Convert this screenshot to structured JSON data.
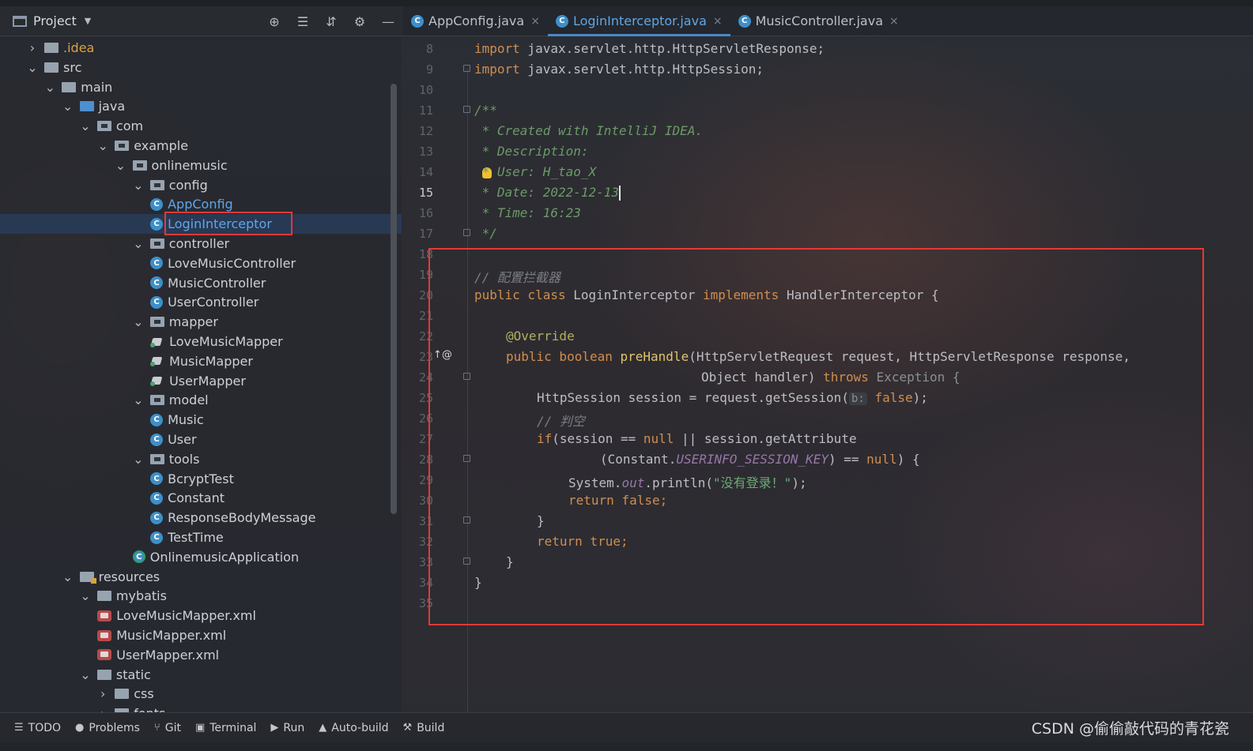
{
  "project_panel": {
    "title": "Project",
    "tools": [
      "locate-icon",
      "expand-all-icon",
      "collapse-all-icon",
      "gear-icon",
      "minimize-icon"
    ]
  },
  "tabs": [
    {
      "label": "AppConfig.java",
      "active": false
    },
    {
      "label": "LoginInterceptor.java",
      "active": true
    },
    {
      "label": "MusicController.java",
      "active": false
    }
  ],
  "tree": [
    {
      "label": ".idea",
      "type": "folder",
      "indent": 1,
      "chev": "right",
      "color": "orange"
    },
    {
      "label": "src",
      "type": "folder",
      "indent": 1,
      "chev": "down"
    },
    {
      "label": "main",
      "type": "folder",
      "indent": 2,
      "chev": "down"
    },
    {
      "label": "java",
      "type": "folder-blue",
      "indent": 3,
      "chev": "down"
    },
    {
      "label": "com",
      "type": "package",
      "indent": 4,
      "chev": "down"
    },
    {
      "label": "example",
      "type": "package",
      "indent": 5,
      "chev": "down"
    },
    {
      "label": "onlinemusic",
      "type": "package",
      "indent": 6,
      "chev": "down"
    },
    {
      "label": "config",
      "type": "package",
      "indent": 7,
      "chev": "down"
    },
    {
      "label": "AppConfig",
      "type": "class",
      "indent": 8,
      "color": "blue"
    },
    {
      "label": "LoginInterceptor",
      "type": "class",
      "indent": 8,
      "color": "blue",
      "selected": true
    },
    {
      "label": "controller",
      "type": "package",
      "indent": 7,
      "chev": "down"
    },
    {
      "label": "LoveMusicController",
      "type": "class",
      "indent": 8
    },
    {
      "label": "MusicController",
      "type": "class",
      "indent": 8
    },
    {
      "label": "UserController",
      "type": "class",
      "indent": 8
    },
    {
      "label": "mapper",
      "type": "package",
      "indent": 7,
      "chev": "down"
    },
    {
      "label": "LoveMusicMapper",
      "type": "mapper",
      "indent": 8
    },
    {
      "label": "MusicMapper",
      "type": "mapper",
      "indent": 8
    },
    {
      "label": "UserMapper",
      "type": "mapper",
      "indent": 8
    },
    {
      "label": "model",
      "type": "package",
      "indent": 7,
      "chev": "down"
    },
    {
      "label": "Music",
      "type": "class",
      "indent": 8
    },
    {
      "label": "User",
      "type": "class",
      "indent": 8
    },
    {
      "label": "tools",
      "type": "package",
      "indent": 7,
      "chev": "down"
    },
    {
      "label": "BcryptTest",
      "type": "class",
      "indent": 8
    },
    {
      "label": "Constant",
      "type": "class",
      "indent": 8
    },
    {
      "label": "ResponseBodyMessage",
      "type": "class",
      "indent": 8
    },
    {
      "label": "TestTime",
      "type": "class",
      "indent": 8
    },
    {
      "label": "OnlinemusicApplication",
      "type": "class-app",
      "indent": 7
    },
    {
      "label": "resources",
      "type": "folder-res",
      "indent": 3,
      "chev": "down"
    },
    {
      "label": "mybatis",
      "type": "folder",
      "indent": 4,
      "chev": "down"
    },
    {
      "label": "LoveMusicMapper.xml",
      "type": "xml",
      "indent": 5
    },
    {
      "label": "MusicMapper.xml",
      "type": "xml",
      "indent": 5
    },
    {
      "label": "UserMapper.xml",
      "type": "xml",
      "indent": 5
    },
    {
      "label": "static",
      "type": "folder",
      "indent": 4,
      "chev": "down"
    },
    {
      "label": "css",
      "type": "folder",
      "indent": 5,
      "chev": "right"
    },
    {
      "label": "fonts",
      "type": "folder",
      "indent": 5,
      "chev": "right"
    }
  ],
  "editor": {
    "line_numbers": [
      "8",
      "9",
      "10",
      "11",
      "12",
      "13",
      "14",
      "15",
      "16",
      "17",
      "18",
      "19",
      "20",
      "21",
      "22",
      "23",
      "24",
      "25",
      "26",
      "27",
      "28",
      "29",
      "30",
      "31",
      "32",
      "33",
      "34",
      "35"
    ],
    "current_line": "15",
    "code": {
      "l8_kw": "import",
      "l8_rest": " javax.servlet.http.HttpServletResponse;",
      "l9_kw": "import",
      "l9_rest": " javax.servlet.http.HttpSession;",
      "l11": "/**",
      "l12": " * Created with IntelliJ IDEA.",
      "l13": " * Description:",
      "l14": " * User: H_tao_X",
      "l15": " * Date: 2022-12-13",
      "l16": " * Time: 16:23",
      "l17": " */",
      "l19": "// 配置拦截器",
      "l20_kw1": "public class",
      "l20_name": " LoginInterceptor ",
      "l20_kw2": "implements",
      "l20_rest": " HandlerInterceptor {",
      "l22": "@Override",
      "l23_kw": "public boolean ",
      "l23_fn": "preHandle",
      "l23_rest": "(HttpServletRequest request, HttpServletResponse response,",
      "l24_a": "Object handler) ",
      "l24_kw": "throws",
      "l24_b": " Exception {",
      "l25_a": "HttpSession session = request.getSession(",
      "l25_hint": "b:",
      "l25_kw": " false",
      "l25_b": ");",
      "l26": "// 判空",
      "l27_kw": "if",
      "l27_a": "(session == ",
      "l27_null": "null",
      "l27_b": " || session.getAttribute",
      "l28_a": "(Constant.",
      "l28_const": "USERINFO_SESSION_KEY",
      "l28_b": ") == ",
      "l28_null": "null",
      "l28_c": ") {",
      "l29_a": "System.",
      "l29_out": "out",
      "l29_b": ".println(",
      "l29_str": "\"没有登录！\"",
      "l29_c": ");",
      "l30": "return false;",
      "l31": "}",
      "l32": "return true;",
      "l33": "}",
      "l34": "}"
    }
  },
  "bottom_bar": [
    {
      "icon": "todo-icon",
      "glyph": "☰",
      "label": "TODO"
    },
    {
      "icon": "problems-icon",
      "glyph": "●",
      "label": "Problems"
    },
    {
      "icon": "git-icon",
      "glyph": "⑂",
      "label": "Git"
    },
    {
      "icon": "terminal-icon",
      "glyph": "▣",
      "label": "Terminal"
    },
    {
      "icon": "run-icon",
      "glyph": "▶",
      "label": "Run"
    },
    {
      "icon": "warning-icon",
      "glyph": "▲",
      "label": "Auto-build"
    },
    {
      "icon": "build-icon",
      "glyph": "⚒",
      "label": "Build"
    }
  ],
  "watermark": "CSDN @偷偷敲代码的青花瓷"
}
